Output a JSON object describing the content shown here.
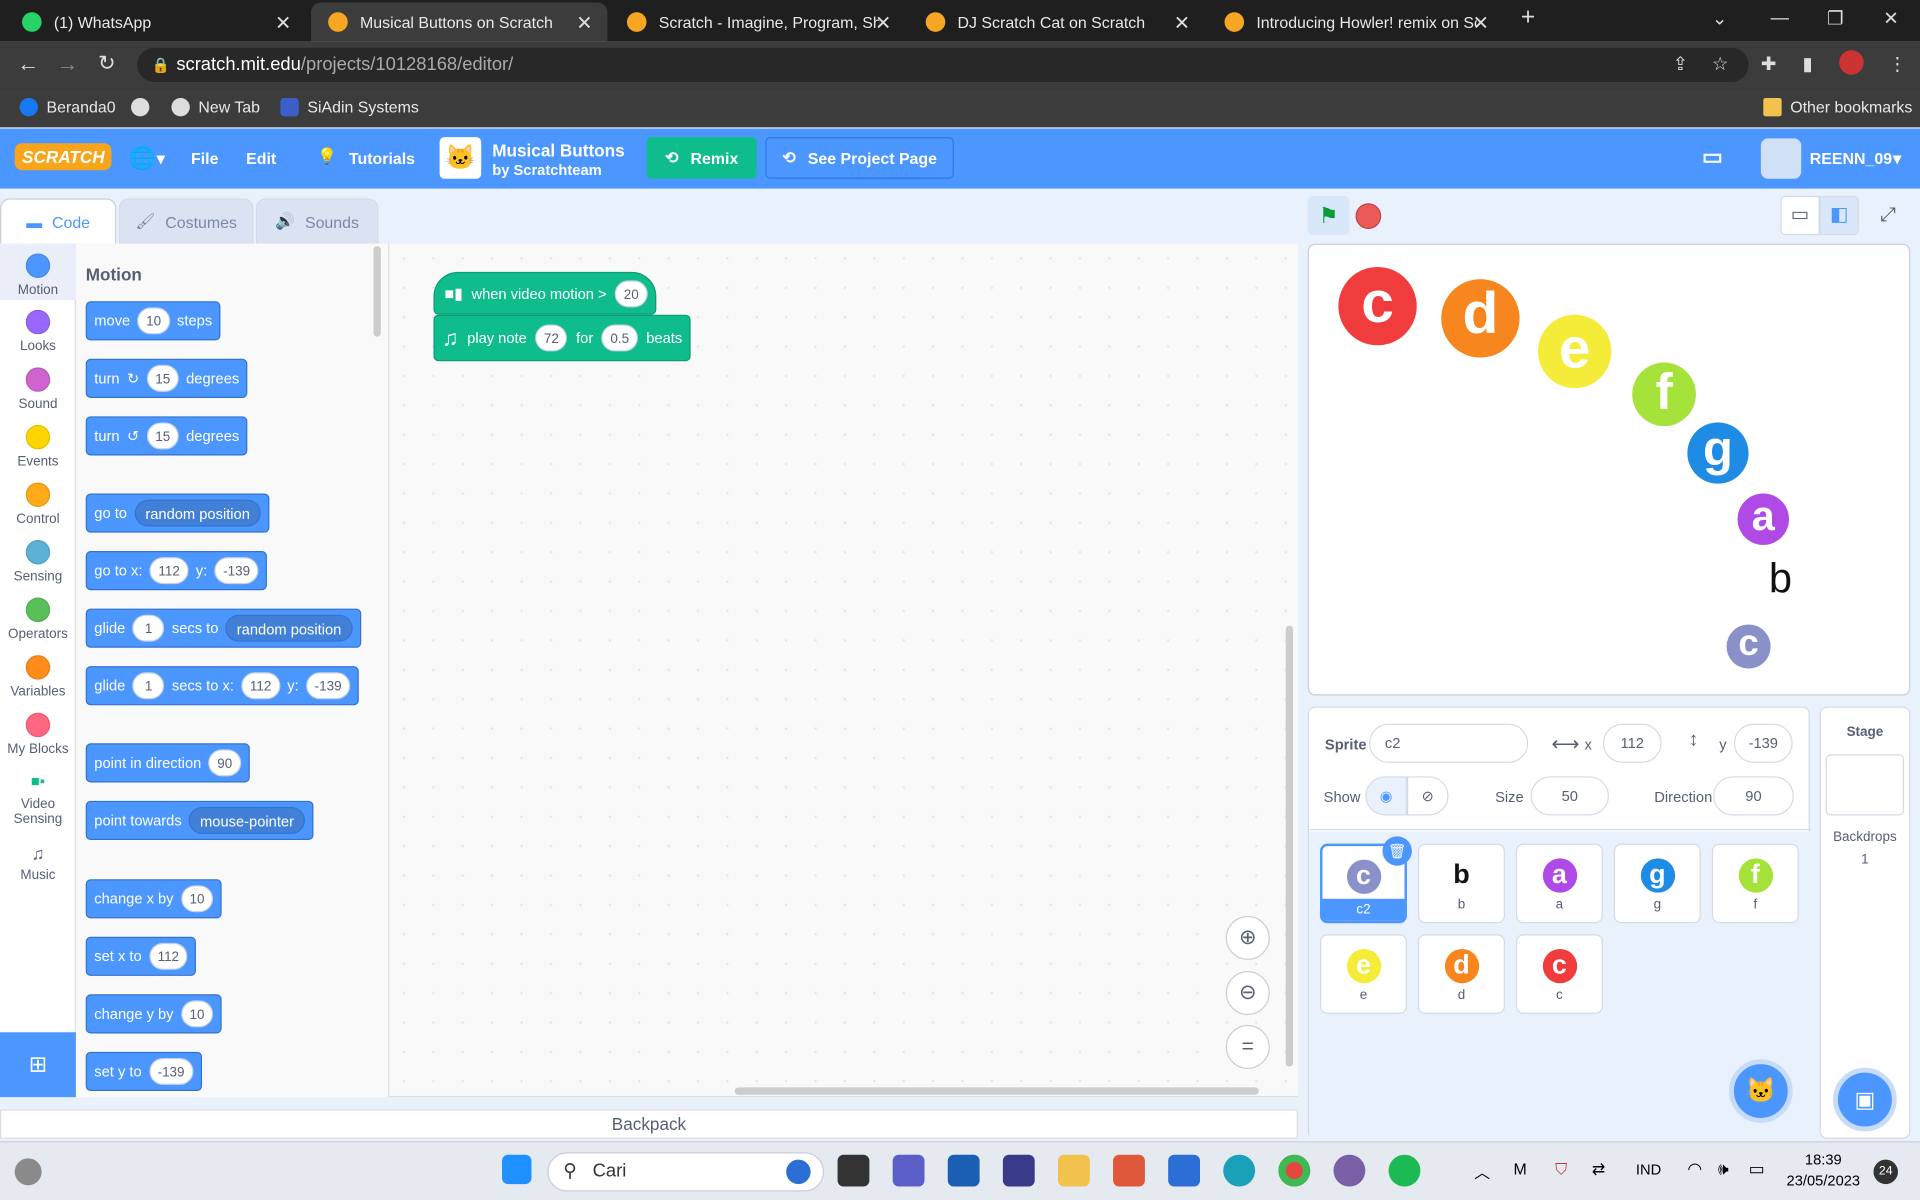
{
  "browser": {
    "tabs": [
      {
        "title": "(1) WhatsApp",
        "color": "#25d366"
      },
      {
        "title": "Musical Buttons on Scratch",
        "color": "#f6a623"
      },
      {
        "title": "Scratch - Imagine, Program, Shar",
        "color": "#f6a623"
      },
      {
        "title": "DJ Scratch Cat on Scratch",
        "color": "#f6a623"
      },
      {
        "title": "Introducing Howler! remix on Scr",
        "color": "#f6a623"
      }
    ],
    "url_host": "scratch.mit.edu",
    "url_path": "/projects/10128168/editor/",
    "bookmarks": [
      "Beranda0",
      "",
      "New Tab",
      "SiAdin Systems"
    ],
    "other_bookmarks": "Other bookmarks"
  },
  "menu": {
    "logo": "SCRATCH",
    "file": "File",
    "edit": "Edit",
    "tutorials": "Tutorials",
    "project_title": "Musical Buttons",
    "author": "by Scratchteam",
    "remix": "Remix",
    "see_project": "See Project Page",
    "user": "REENN_09"
  },
  "editor_tabs": {
    "code": "Code",
    "costumes": "Costumes",
    "sounds": "Sounds"
  },
  "categories": [
    {
      "label": "Motion",
      "color": "#4c97ff"
    },
    {
      "label": "Looks",
      "color": "#9966ff"
    },
    {
      "label": "Sound",
      "color": "#cf63cf"
    },
    {
      "label": "Events",
      "color": "#ffd500"
    },
    {
      "label": "Control",
      "color": "#ffab19"
    },
    {
      "label": "Sensing",
      "color": "#5cb1d6"
    },
    {
      "label": "Operators",
      "color": "#59c059"
    },
    {
      "label": "Variables",
      "color": "#ff8c1a"
    },
    {
      "label": "My Blocks",
      "color": "#ff6680"
    },
    {
      "label": "Video Sensing",
      "color": ""
    },
    {
      "label": "Music",
      "color": ""
    }
  ],
  "palette": {
    "heading": "Motion",
    "b_move": [
      "move",
      "10",
      "steps"
    ],
    "b_turn_r": [
      "turn",
      "15",
      "degrees"
    ],
    "b_turn_l": [
      "turn",
      "15",
      "degrees"
    ],
    "b_goto": [
      "go to",
      "random position"
    ],
    "b_gotoxy": [
      "go to x:",
      "112",
      "y:",
      "-139"
    ],
    "b_glide": [
      "glide",
      "1",
      "secs to",
      "random position"
    ],
    "b_glidexy": [
      "glide",
      "1",
      "secs to x:",
      "112",
      "y:",
      "-139"
    ],
    "b_dir": [
      "point in direction",
      "90"
    ],
    "b_towards": [
      "point towards",
      "mouse-pointer"
    ],
    "b_chx": [
      "change x by",
      "10"
    ],
    "b_setx": [
      "set x to",
      "112"
    ],
    "b_chy": [
      "change y by",
      "10"
    ],
    "b_sety": [
      "set y to",
      "-139"
    ]
  },
  "script": {
    "hat": [
      "when video motion >",
      "20"
    ],
    "note": [
      "play note",
      "72",
      "for",
      "0.5",
      "beats"
    ]
  },
  "backpack": "Backpack",
  "stage_sprites": [
    {
      "letter": "c",
      "color": "#f03c3c"
    },
    {
      "letter": "d",
      "color": "#f7861f"
    },
    {
      "letter": "e",
      "color": "#f5ec3a"
    },
    {
      "letter": "f",
      "color": "#a6e33a"
    },
    {
      "letter": "g",
      "color": "#1e8ce4"
    },
    {
      "letter": "a",
      "color": "#b04ae6"
    },
    {
      "letter": "b",
      "color": ""
    },
    {
      "letter": "c",
      "color": "#8a91c9"
    }
  ],
  "sprite_info": {
    "sprite_label": "Sprite",
    "name": "c2",
    "x_label": "x",
    "x": "112",
    "y_label": "y",
    "y": "-139",
    "show_label": "Show",
    "size_label": "Size",
    "size": "50",
    "direction_label": "Direction",
    "direction": "90"
  },
  "sprite_list": [
    {
      "name": "c2",
      "letter": "c",
      "color": "#8a91c9"
    },
    {
      "name": "b",
      "letter": "b",
      "color": "#ffffff"
    },
    {
      "name": "a",
      "letter": "a",
      "color": "#b04ae6"
    },
    {
      "name": "g",
      "letter": "g",
      "color": "#1e8ce4"
    },
    {
      "name": "f",
      "letter": "f",
      "color": "#a6e33a"
    },
    {
      "name": "e",
      "letter": "e",
      "color": "#f5ec3a"
    },
    {
      "name": "d",
      "letter": "d",
      "color": "#f7861f"
    },
    {
      "name": "c",
      "letter": "c",
      "color": "#f03c3c"
    }
  ],
  "stage_panel": {
    "title": "Stage",
    "backdrops_label": "Backdrops",
    "backdrops": "1"
  },
  "taskbar": {
    "search": "Cari",
    "lang": "IND",
    "time": "18:39",
    "date": "23/05/2023",
    "badge": "24"
  }
}
